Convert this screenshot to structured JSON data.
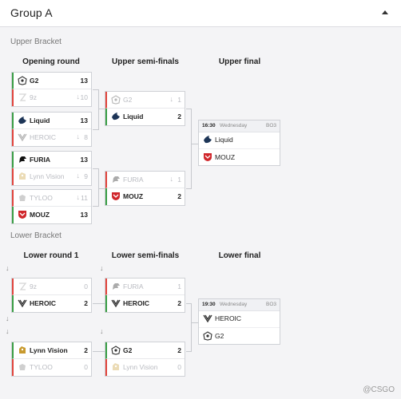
{
  "header": {
    "title": "Group A"
  },
  "upper": {
    "label": "Upper Bracket",
    "columns": [
      "Opening round",
      "Upper semi-finals",
      "Upper final"
    ],
    "opening": [
      [
        {
          "team": "G2",
          "score": "13",
          "result": "win",
          "logo": "g2-logo"
        },
        {
          "team": "9z",
          "score": "10",
          "result": "loss",
          "logo": "9z-logo"
        }
      ],
      [
        {
          "team": "Liquid",
          "score": "13",
          "result": "win",
          "logo": "liquid-logo"
        },
        {
          "team": "HEROIC",
          "score": "8",
          "result": "loss",
          "logo": "heroic-logo"
        }
      ],
      [
        {
          "team": "FURIA",
          "score": "13",
          "result": "win",
          "logo": "furia-logo"
        },
        {
          "team": "Lynn Vision",
          "score": "9",
          "result": "loss",
          "logo": "lynn-vision-logo"
        }
      ],
      [
        {
          "team": "TYLOO",
          "score": "11",
          "result": "loss",
          "logo": "tyloo-logo"
        },
        {
          "team": "MOUZ",
          "score": "13",
          "result": "win",
          "logo": "mouz-logo"
        }
      ]
    ],
    "semis": [
      [
        {
          "team": "G2",
          "score": "1",
          "result": "loss",
          "logo": "g2-logo"
        },
        {
          "team": "Liquid",
          "score": "2",
          "result": "win",
          "logo": "liquid-logo"
        }
      ],
      [
        {
          "team": "FURIA",
          "score": "1",
          "result": "loss",
          "logo": "furia-logo"
        },
        {
          "team": "MOUZ",
          "score": "2",
          "result": "win",
          "logo": "mouz-logo"
        }
      ]
    ],
    "final": {
      "time": "16:30",
      "day": "Wednesday",
      "format": "BO3",
      "teams": [
        {
          "team": "Liquid",
          "logo": "liquid-logo"
        },
        {
          "team": "MOUZ",
          "logo": "mouz-logo"
        }
      ]
    }
  },
  "lower": {
    "label": "Lower Bracket",
    "columns": [
      "Lower round 1",
      "Lower semi-finals",
      "Lower final"
    ],
    "round1": [
      [
        {
          "team": "9z",
          "score": "0",
          "result": "loss",
          "logo": "9z-logo"
        },
        {
          "team": "HEROIC",
          "score": "2",
          "result": "win",
          "logo": "heroic-logo"
        }
      ],
      [
        {
          "team": "Lynn Vision",
          "score": "2",
          "result": "win",
          "logo": "lynn-vision-logo"
        },
        {
          "team": "TYLOO",
          "score": "0",
          "result": "loss",
          "logo": "tyloo-logo"
        }
      ]
    ],
    "semis": [
      [
        {
          "team": "FURIA",
          "score": "1",
          "result": "loss",
          "logo": "furia-logo"
        },
        {
          "team": "HEROIC",
          "score": "2",
          "result": "win",
          "logo": "heroic-logo"
        }
      ],
      [
        {
          "team": "G2",
          "score": "2",
          "result": "win",
          "logo": "g2-logo"
        },
        {
          "team": "Lynn Vision",
          "score": "0",
          "result": "loss",
          "logo": "lynn-vision-logo"
        }
      ]
    ],
    "final": {
      "time": "19:30",
      "day": "Wednesday",
      "format": "BO3",
      "teams": [
        {
          "team": "HEROIC",
          "logo": "heroic-logo"
        },
        {
          "team": "G2",
          "logo": "g2-logo"
        }
      ]
    }
  },
  "watermark": "@CSGO",
  "colors": {
    "win": "#3a9e45",
    "loss": "#e1443c",
    "liquid": "#1d3557",
    "mouz": "#d0262b",
    "lynn": "#c89a2e"
  }
}
